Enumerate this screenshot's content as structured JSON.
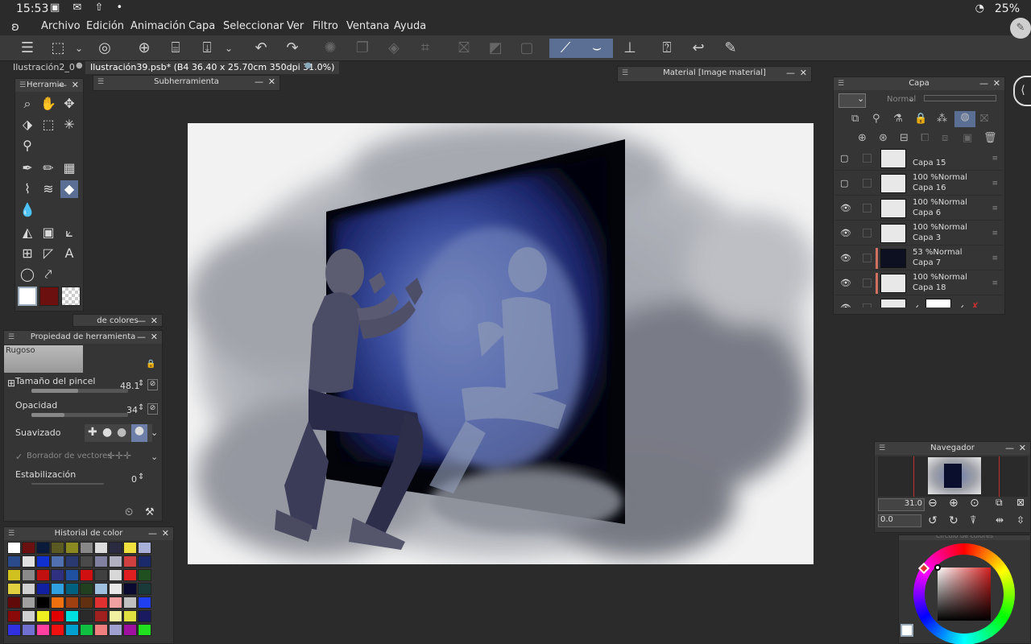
{
  "status": {
    "time": "15:53",
    "battery": "25%"
  },
  "menu": {
    "items": [
      "Archivo",
      "Edición",
      "Animación",
      "Capa",
      "Seleccionar",
      "Ver",
      "Filtro",
      "Ventana",
      "Ayuda"
    ]
  },
  "tabs": {
    "tab1": "Ilustración2_0",
    "tab2": "Ilustración39.psb* (B4 36.40 x 25.70cm 350dpi 31.0%)"
  },
  "panels": {
    "tools_title": "Herramie",
    "subtool_title": "Subherramienta",
    "material_title": "Material [Image material]",
    "layer_title": "Capa",
    "navigator_title": "Navegador",
    "color_history_title": "Historial de color",
    "color_set_title": "de colores",
    "tool_property_title": "Propiedad de herramienta",
    "color_circle_title": "Círculo de colores"
  },
  "tool_property": {
    "brush_name": "Rugoso",
    "brush_size_label": "Tamaño del pincel",
    "brush_size_value": "48.1",
    "opacity_label": "Opacidad",
    "opacity_value": "34",
    "opacity_fraction": 0.34,
    "brush_size_fraction": 0.48,
    "smoothing_label": "Suavizado",
    "vector_eraser_label": "Borrador de vectores",
    "stabilization_label": "Estabilización",
    "stabilization_value": "0"
  },
  "layers": {
    "blend_mode": "Normal",
    "items": [
      {
        "mode": "",
        "name": "Capa 15",
        "visible": false,
        "clip": false,
        "thumb": "light"
      },
      {
        "mode": "100 %Normal",
        "name": "Capa 16",
        "visible": false,
        "clip": false,
        "thumb": "light"
      },
      {
        "mode": "100 %Normal",
        "name": "Capa 6",
        "visible": true,
        "clip": false,
        "thumb": "light"
      },
      {
        "mode": "100 %Normal",
        "name": "Capa 3",
        "visible": true,
        "clip": false,
        "thumb": "light"
      },
      {
        "mode": "53 %Normal",
        "name": "Capa 7",
        "visible": true,
        "clip": true,
        "thumb": "dark"
      },
      {
        "mode": "100 %Normal",
        "name": "Capa 18",
        "visible": true,
        "clip": true,
        "thumb": "light"
      }
    ]
  },
  "navigator": {
    "zoom": "31.0",
    "rotation": "0.0"
  },
  "colors": {
    "accent": "#5b6f95",
    "main_color": "#ffffff",
    "sub_color": "#6b0f0f",
    "history": [
      "#ffffff",
      "#6b1010",
      "#0a1a3a",
      "#5a5a22",
      "#8a8a20",
      "#888888",
      "#dcdcdc",
      "#2a2a40",
      "#f0e040",
      "#a8b0d8",
      "#2a4a8a",
      "#e0e0e0",
      "#1030d0",
      "#5070b0",
      "#2a3a70",
      "#4a4a4a",
      "#8080a0",
      "#b0b0c0",
      "#d04040",
      "#1a2a6a",
      "#d0c020",
      "#8a8a8a",
      "#c01010",
      "#303080",
      "#2050a0",
      "#d01010",
      "#404040",
      "#d8d8d8",
      "#e02020",
      "#205020",
      "#e0d040",
      "#d0d0d0",
      "#1020a0",
      "#30a0e0",
      "#006080",
      "#204020",
      "#a0c0e0",
      "#e8e8e8",
      "#0a0a30",
      "#1a3a3a",
      "#600a0a",
      "#a0a0a0",
      "#000000",
      "#f07010",
      "#a04010",
      "#603010",
      "#e03030",
      "#f0a0a0",
      "#c0c0c0",
      "#2040f0",
      "#8a0a0a",
      "#d0d0d0",
      "#f0f020",
      "#e00000",
      "#00e0e0",
      "#2a2a2a",
      "#a02020",
      "#f0f0a0",
      "#e0e040",
      "#1a1a60",
      "#3030e0",
      "#7070d0",
      "#ff40a0",
      "#f01010",
      "#00a0d0",
      "#10c040",
      "#f08080",
      "#a0a0d0",
      "#a010a0",
      "#20e020"
    ]
  }
}
